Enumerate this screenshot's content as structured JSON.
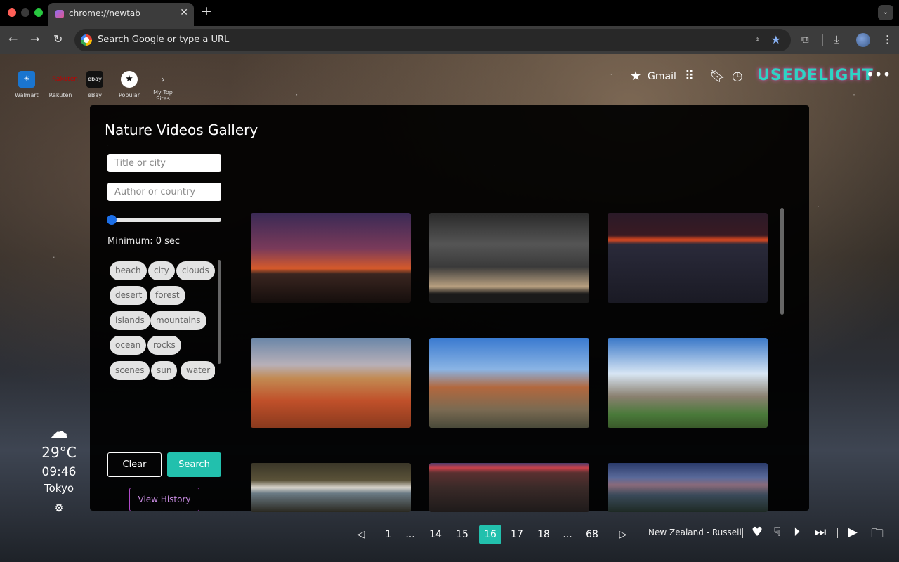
{
  "browser": {
    "tab_title": "chrome://newtab",
    "address_placeholder": "Search Google or type a URL"
  },
  "shortcuts": [
    {
      "label": "Walmart",
      "icon": "walmart-icon",
      "color": "#1a75cf"
    },
    {
      "label": "Rakuten",
      "icon": "rakuten-icon",
      "color": "#bf0000"
    },
    {
      "label": "eBay",
      "icon": "ebay-icon",
      "color": "#111111",
      "text": "ebay"
    },
    {
      "label": "Popular",
      "icon": "star-icon",
      "color": "#ffffff"
    },
    {
      "label": "My Top Sites",
      "icon": "chevron-right-icon"
    }
  ],
  "topbar": {
    "gmail": "Gmail",
    "logo": "USEDELIGHT"
  },
  "gallery": {
    "title": "Nature Videos Gallery",
    "title_placeholder": "Title or city",
    "author_placeholder": "Author or country",
    "slider_value_fraction": 0.0,
    "minimum_label": "Minimum: 0 sec",
    "tags": [
      "beach",
      "city",
      "clouds",
      "desert",
      "forest",
      "islands",
      "mountains",
      "ocean",
      "rocks",
      "scenes",
      "sun",
      "water"
    ],
    "clear_label": "Clear",
    "search_label": "Search",
    "history_label": "View History",
    "pagination": {
      "pages": [
        "1",
        "...",
        "14",
        "15",
        "16",
        "17",
        "18",
        "...",
        "68"
      ],
      "current": "16"
    },
    "accent": "#22c0ad"
  },
  "weather": {
    "temp": "29°C",
    "time": "09:46",
    "city": "Tokyo"
  },
  "footer": {
    "credit": "New Zealand - Russell"
  }
}
